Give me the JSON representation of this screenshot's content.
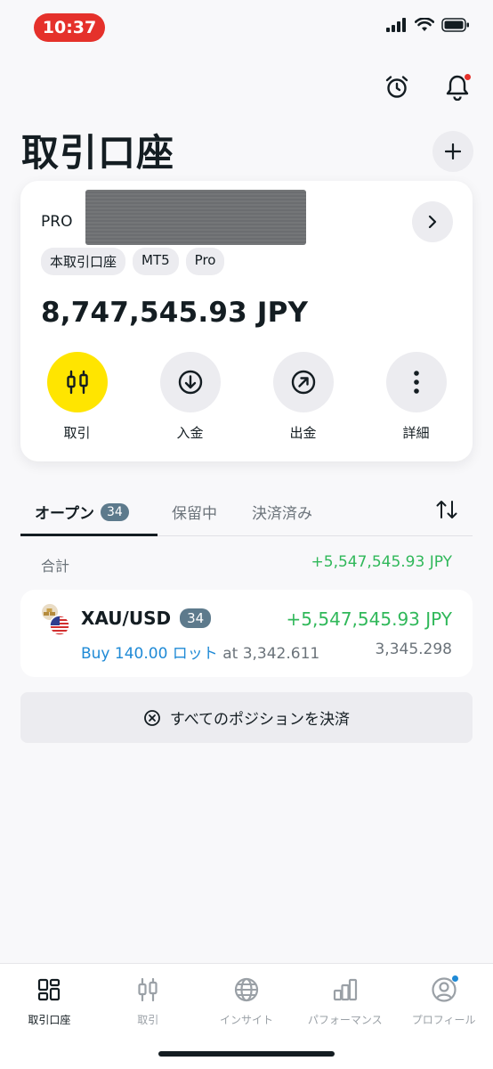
{
  "status_bar": {
    "time": "10:37"
  },
  "header": {
    "title": "取引口座"
  },
  "account": {
    "name": "PRO",
    "tags": [
      "本取引口座",
      "MT5",
      "Pro"
    ],
    "balance": "8,747,545.93 JPY",
    "actions": [
      {
        "label": "取引",
        "icon": "candlestick-icon"
      },
      {
        "label": "入金",
        "icon": "arrow-down-circle-icon"
      },
      {
        "label": "出金",
        "icon": "arrow-up-right-circle-icon"
      },
      {
        "label": "詳細",
        "icon": "more-vertical-icon"
      }
    ]
  },
  "tabs": [
    {
      "label": "オープン",
      "badge": "34",
      "active": true
    },
    {
      "label": "保留中"
    },
    {
      "label": "決済済み"
    }
  ],
  "total": {
    "label": "合計",
    "value": "+5,547,545.93 JPY"
  },
  "position": {
    "symbol": "XAU/USD",
    "count": "34",
    "profit": "+5,547,545.93 JPY",
    "side_volume": "Buy 140.00 ロット",
    "at_label": "at",
    "open_price": "3,342.611",
    "current_price": "3,345.298"
  },
  "close_all": {
    "label": "すべてのポジションを決済"
  },
  "bottom_nav": [
    {
      "label": "取引口座",
      "icon": "accounts-grid-icon",
      "active": true
    },
    {
      "label": "取引",
      "icon": "candlestick-icon"
    },
    {
      "label": "インサイト",
      "icon": "globe-icon"
    },
    {
      "label": "パフォーマンス",
      "icon": "bar-chart-icon"
    },
    {
      "label": "プロフィール",
      "icon": "user-circle-icon"
    }
  ],
  "colors": {
    "accent_yellow": "#ffe500",
    "profit_green": "#30b85a",
    "buy_blue": "#1f8ad6",
    "alert_red": "#e5312b",
    "badge_slate": "#5d7a8c"
  }
}
